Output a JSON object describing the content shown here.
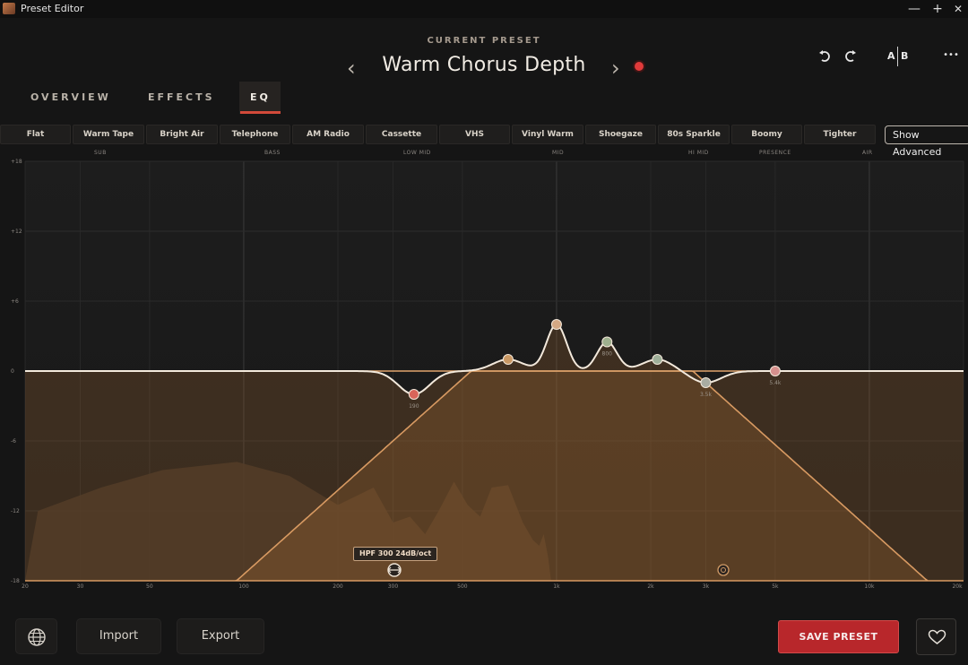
{
  "window": {
    "title": "Preset Editor",
    "controls": {
      "minimize": "—",
      "maximize": "+",
      "close": "✕"
    }
  },
  "header": {
    "label": "CURRENT PRESET",
    "preset_name": "Warm Chorus Depth",
    "prev_arrow": "‹",
    "next_arrow": "›",
    "ab_a": "A",
    "ab_b": "B",
    "more": "•••",
    "record_color": "#e03a3a"
  },
  "tabs": [
    {
      "label": "OVERVIEW",
      "active": false
    },
    {
      "label": "EFFECTS",
      "active": false
    },
    {
      "label": "EQ",
      "active": true
    }
  ],
  "presets": [
    "Flat",
    "Warm Tape",
    "Bright Air",
    "Telephone",
    "AM Radio",
    "Cassette",
    "VHS",
    "Vinyl Warm",
    "Shoegaze",
    "80s Sparkle",
    "Boomy",
    "Tighter"
  ],
  "show_advanced": "Show Advanced",
  "bands": [
    "SUB",
    "BASS",
    "LOW MID",
    "MID",
    "HI MID",
    "PRESENCE",
    "AIR"
  ],
  "eq": {
    "y_labels": [
      "+18",
      "+12",
      "+6",
      "0",
      "-6",
      "-12",
      "-18"
    ],
    "x_labels": [
      "20",
      "30",
      "50",
      "100",
      "200",
      "300",
      "500",
      "1k",
      "2k",
      "3k",
      "5k",
      "10k",
      "20k"
    ],
    "nodes": [
      {
        "freq": 350,
        "gain": -2,
        "label": "190",
        "color": "#d9655a"
      },
      {
        "freq": 700,
        "gain": 1,
        "label": "",
        "color": "#c99864"
      },
      {
        "freq": 1000,
        "gain": 4,
        "label": "",
        "color": "#d4a884"
      },
      {
        "freq": 1450,
        "gain": 2.5,
        "label": "800",
        "color": "#9fb08e"
      },
      {
        "freq": 2100,
        "gain": 1,
        "label": "",
        "color": "#9fb09a"
      },
      {
        "freq": 3000,
        "gain": -1,
        "label": "3.5k",
        "color": "#a9aca2"
      },
      {
        "freq": 5000,
        "gain": 0,
        "label": "5.4k",
        "color": "#d68f8c"
      }
    ],
    "hpf": {
      "freq": 300,
      "slope": "24dB/oct",
      "tag": "HPF 300  24dB/oct"
    },
    "accent_color": "#e8b07a"
  },
  "footer": {
    "import_label": "Import",
    "export_label": "Export",
    "save_label": "SAVE PRESET"
  }
}
